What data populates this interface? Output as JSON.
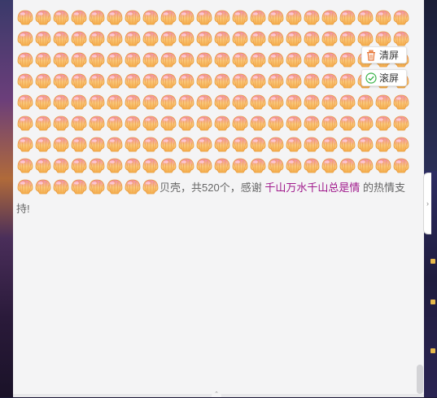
{
  "chat": {
    "shell_icon": "shell-gift-icon",
    "shell_count_displayed": 184,
    "message_prefix": "贝壳，共520个，感谢",
    "sender_name": "千山万水千山总是情",
    "message_suffix": "的热情支持!"
  },
  "controls": {
    "clear_label": "清屏",
    "scroll_label": "滚屏"
  },
  "colors": {
    "panel_bg": "#f4f4f5",
    "user_link": "#a0198c",
    "shell_orange": "#f6b04a",
    "shell_pink": "#f08ab0"
  }
}
